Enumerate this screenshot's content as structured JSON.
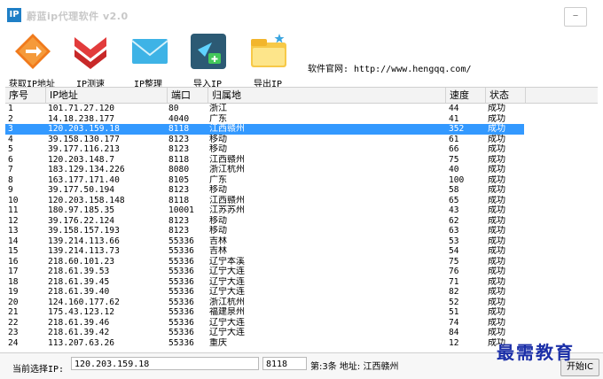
{
  "window": {
    "title": "蔚蓝ip代理软件 v2.0",
    "icon_text": "IP"
  },
  "toolbar": {
    "get_ip": "获取IP地址",
    "test": "IP测速",
    "organize": "IP整理",
    "import": "导入IP",
    "export": "导出IP",
    "site_label": "软件官网: http://www.hengqq.com/"
  },
  "table": {
    "headers": [
      "序号",
      "IP地址",
      "端口",
      "归属地",
      "速度",
      "状态"
    ],
    "rows": [
      {
        "n": "1",
        "ip": "101.71.27.120",
        "port": "80",
        "loc": "浙江",
        "speed": "44",
        "status": "成功"
      },
      {
        "n": "2",
        "ip": "14.18.238.177",
        "port": "4040",
        "loc": "广东",
        "speed": "41",
        "status": "成功"
      },
      {
        "n": "3",
        "ip": "120.203.159.18",
        "port": "8118",
        "loc": "江西赣州",
        "speed": "352",
        "status": "成功"
      },
      {
        "n": "4",
        "ip": "39.158.130.177",
        "port": "8123",
        "loc": "移动",
        "speed": "61",
        "status": "成功"
      },
      {
        "n": "5",
        "ip": "39.177.116.213",
        "port": "8123",
        "loc": "移动",
        "speed": "66",
        "status": "成功"
      },
      {
        "n": "6",
        "ip": "120.203.148.7",
        "port": "8118",
        "loc": "江西赣州",
        "speed": "75",
        "status": "成功"
      },
      {
        "n": "7",
        "ip": "183.129.134.226",
        "port": "8080",
        "loc": "浙江杭州",
        "speed": "40",
        "status": "成功"
      },
      {
        "n": "8",
        "ip": "163.177.171.40",
        "port": "8105",
        "loc": "广东",
        "speed": "100",
        "status": "成功"
      },
      {
        "n": "9",
        "ip": "39.177.50.194",
        "port": "8123",
        "loc": "移动",
        "speed": "58",
        "status": "成功"
      },
      {
        "n": "10",
        "ip": "120.203.158.148",
        "port": "8118",
        "loc": "江西赣州",
        "speed": "65",
        "status": "成功"
      },
      {
        "n": "11",
        "ip": "180.97.185.35",
        "port": "10001",
        "loc": "江苏苏州",
        "speed": "43",
        "status": "成功"
      },
      {
        "n": "12",
        "ip": "39.176.22.124",
        "port": "8123",
        "loc": "移动",
        "speed": "62",
        "status": "成功"
      },
      {
        "n": "13",
        "ip": "39.158.157.193",
        "port": "8123",
        "loc": "移动",
        "speed": "63",
        "status": "成功"
      },
      {
        "n": "14",
        "ip": "139.214.113.66",
        "port": "55336",
        "loc": "吉林",
        "speed": "53",
        "status": "成功"
      },
      {
        "n": "15",
        "ip": "139.214.113.73",
        "port": "55336",
        "loc": "吉林",
        "speed": "54",
        "status": "成功"
      },
      {
        "n": "16",
        "ip": "218.60.101.23",
        "port": "55336",
        "loc": "辽宁本溪",
        "speed": "75",
        "status": "成功"
      },
      {
        "n": "17",
        "ip": "218.61.39.53",
        "port": "55336",
        "loc": "辽宁大连",
        "speed": "76",
        "status": "成功"
      },
      {
        "n": "18",
        "ip": "218.61.39.45",
        "port": "55336",
        "loc": "辽宁大连",
        "speed": "71",
        "status": "成功"
      },
      {
        "n": "19",
        "ip": "218.61.39.40",
        "port": "55336",
        "loc": "辽宁大连",
        "speed": "82",
        "status": "成功"
      },
      {
        "n": "20",
        "ip": "124.160.177.62",
        "port": "55336",
        "loc": "浙江杭州",
        "speed": "52",
        "status": "成功"
      },
      {
        "n": "21",
        "ip": "175.43.123.12",
        "port": "55336",
        "loc": "福建泉州",
        "speed": "51",
        "status": "成功"
      },
      {
        "n": "22",
        "ip": "218.61.39.46",
        "port": "55336",
        "loc": "辽宁大连",
        "speed": "74",
        "status": "成功"
      },
      {
        "n": "23",
        "ip": "218.61.39.42",
        "port": "55336",
        "loc": "辽宁大连",
        "speed": "84",
        "status": "成功"
      },
      {
        "n": "24",
        "ip": "113.207.63.26",
        "port": "55336",
        "loc": "重庆",
        "speed": "12",
        "status": "成功"
      }
    ],
    "selected_index": 2
  },
  "status": {
    "label": "当前选择IP:",
    "ip": "120.203.159.18",
    "port": "8118",
    "info": "第:3条  地址: 江西赣州",
    "button": "开始IC"
  },
  "watermark": "最需教育",
  "colors": {
    "selection": "#3399ff",
    "watermark": "#1b2fa8"
  }
}
